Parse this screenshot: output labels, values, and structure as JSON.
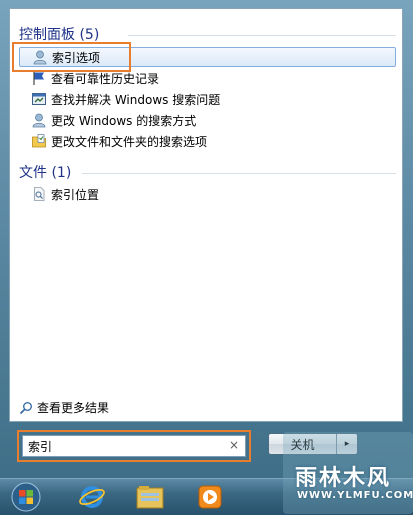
{
  "groups": [
    {
      "title": "控制面板 (5)",
      "items": [
        {
          "label": "索引选项",
          "icon": "user-options-icon",
          "selected": true
        },
        {
          "label": "查看可靠性历史记录",
          "icon": "flag-icon"
        },
        {
          "label": "查找并解决 Windows 搜索问题",
          "icon": "troubleshoot-icon"
        },
        {
          "label": "更改 Windows 的搜索方式",
          "icon": "user-options-icon"
        },
        {
          "label": "更改文件和文件夹的搜索选项",
          "icon": "folder-options-icon"
        }
      ]
    },
    {
      "title": "文件 (1)",
      "items": [
        {
          "label": "索引位置",
          "icon": "search-file-icon"
        }
      ]
    }
  ],
  "see_more": "查看更多结果",
  "search": {
    "value": "索引",
    "clear_glyph": "×"
  },
  "shutdown": {
    "label": "关机",
    "arrow": "▸"
  },
  "taskbar": {
    "items": [
      "start-orb-icon",
      "internet-explorer-icon",
      "file-explorer-icon",
      "media-player-icon"
    ]
  },
  "watermark": {
    "text": "雨林木风",
    "sub": "WWW.YLMFU.COM"
  },
  "colors": {
    "group_title": "#1e3287",
    "highlight": "#e87d2e",
    "selection_border": "#84acdd"
  }
}
